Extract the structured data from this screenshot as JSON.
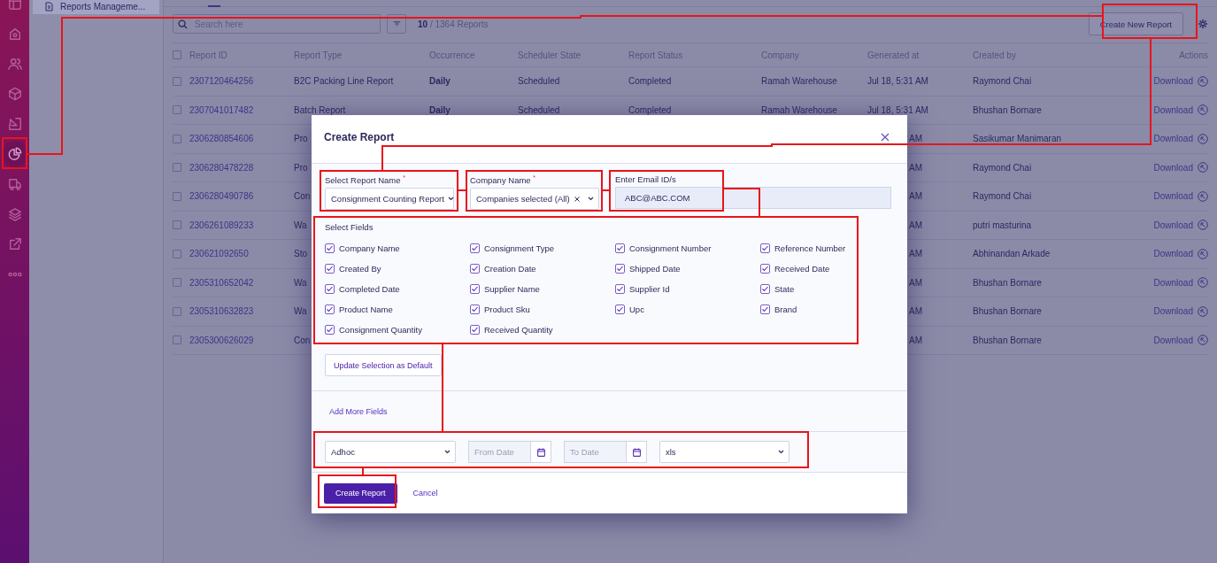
{
  "nav_rail": [
    {
      "selected": false
    },
    {
      "selected": false
    },
    {
      "selected": false
    },
    {
      "selected": false
    },
    {
      "selected": false
    },
    {
      "selected": true
    },
    {
      "selected": false
    },
    {
      "selected": false
    },
    {
      "selected": false
    },
    {
      "selected": false
    }
  ],
  "sidebar": {
    "items": [
      {
        "label": "Reports Manageme...",
        "selected": true
      }
    ]
  },
  "toolbar": {
    "search": {
      "placeholder": "Search here"
    },
    "count": "**10** / 1364 Reports",
    "create_button": "Create New Report"
  },
  "table": {
    "select_all": {
      "checked": false
    },
    "columns": [
      "Report ID",
      "Report Type",
      "Occurrence",
      "Scheduler State",
      "Report Status",
      "Company",
      "Generated at",
      "Created by",
      "Actions"
    ],
    "rows": [
      {
        "kind": "full",
        "checked": false,
        "report_id": "2307120464256",
        "report_type": "B2C Packing Line Report",
        "occurrence": "Daily",
        "scheduler_state": "Scheduled",
        "report_status": "Completed",
        "company": "Ramah Warehouse",
        "generated_at": "Jul 18, 5:31 AM",
        "created_by": "Raymond Chai",
        "action": "Download"
      },
      {
        "kind": "full",
        "checked": false,
        "report_id": "2307041017482",
        "report_type": "Batch Report",
        "occurrence": "Daily",
        "scheduler_state": "Scheduled",
        "report_status": "Completed",
        "company": "Ramah Warehouse",
        "generated_at": "Jul 18, 5:31 AM",
        "created_by": "Bhushan Bornare",
        "action": "Download"
      },
      {
        "kind": "covered",
        "checked": false,
        "report_id": "2306280854606",
        "report_type": "Pro",
        "generated_at": "AM",
        "created_by": "Sasikumar Manimaran",
        "action": "Download"
      },
      {
        "kind": "covered",
        "checked": false,
        "report_id": "2306280478228",
        "report_type": "Pro",
        "generated_at": "AM",
        "created_by": "Raymond Chai",
        "action": "Download"
      },
      {
        "kind": "covered",
        "checked": false,
        "report_id": "2306280490786",
        "report_type": "Con",
        "generated_at": "AM",
        "created_by": "Raymond Chai",
        "action": "Download"
      },
      {
        "kind": "covered",
        "checked": false,
        "report_id": "2306261089233",
        "report_type": "Wa",
        "generated_at": "AM",
        "created_by": "putri masturina",
        "action": "Download"
      },
      {
        "kind": "covered",
        "checked": false,
        "report_id": "230621092650",
        "report_type": "Sto",
        "generated_at": "AM",
        "created_by": "Abhinandan Arkade",
        "action": "Download"
      },
      {
        "kind": "covered",
        "checked": false,
        "report_id": "2305310652042",
        "report_type": "Wa",
        "generated_at": "AM",
        "created_by": "Bhushan Bornare",
        "action": "Download"
      },
      {
        "kind": "covered",
        "checked": false,
        "report_id": "2305310632823",
        "report_type": "Wa",
        "generated_at": "AM",
        "created_by": "Bhushan Bornare",
        "action": "Download"
      },
      {
        "kind": "covered",
        "checked": false,
        "report_id": "2305300626029",
        "report_type": "Con",
        "generated_at": "AM",
        "created_by": "Bhushan Bornare",
        "action": "Download"
      }
    ]
  },
  "dialog": {
    "title": "Create Report",
    "report_name": {
      "label": "Select Report Name $^{*}$",
      "value": "Consignment Counting Report"
    },
    "company": {
      "label": "Company Name $^{*}$",
      "value": "Companies selected (All)"
    },
    "email": {
      "label": "Enter Email ID/s",
      "value": "ABC@ABC.COM"
    },
    "fields_label": "Select Fields",
    "fields": [
      {
        "label": "Company Name",
        "checked": true
      },
      {
        "label": "Consignment Type",
        "checked": true
      },
      {
        "label": "Consignment Number",
        "checked": true
      },
      {
        "label": "Reference Number",
        "checked": true
      },
      {
        "label": "Created By",
        "checked": true
      },
      {
        "label": "Creation Date",
        "checked": true
      },
      {
        "label": "Shipped Date",
        "checked": true
      },
      {
        "label": "Received Date",
        "checked": true
      },
      {
        "label": "Completed Date",
        "checked": true
      },
      {
        "label": "Supplier Name",
        "checked": true
      },
      {
        "label": "Supplier Id",
        "checked": true
      },
      {
        "label": "State",
        "checked": true
      },
      {
        "label": "Product Name",
        "checked": true
      },
      {
        "label": "Product Sku",
        "checked": true
      },
      {
        "label": "Upc",
        "checked": true
      },
      {
        "label": "Brand",
        "checked": true
      },
      {
        "label": "Consignment Quantity",
        "checked": true
      },
      {
        "label": "Received Quantity",
        "checked": true
      }
    ],
    "default_button": "Update Selection as Default",
    "add_more": "Add More Fields",
    "schedule": {
      "value": "Adhoc"
    },
    "from_date": {
      "placeholder": "From Date"
    },
    "to_date": {
      "placeholder": "To Date"
    },
    "format": {
      "value": "xls"
    },
    "submit": "Create Report",
    "cancel": "Cancel"
  }
}
